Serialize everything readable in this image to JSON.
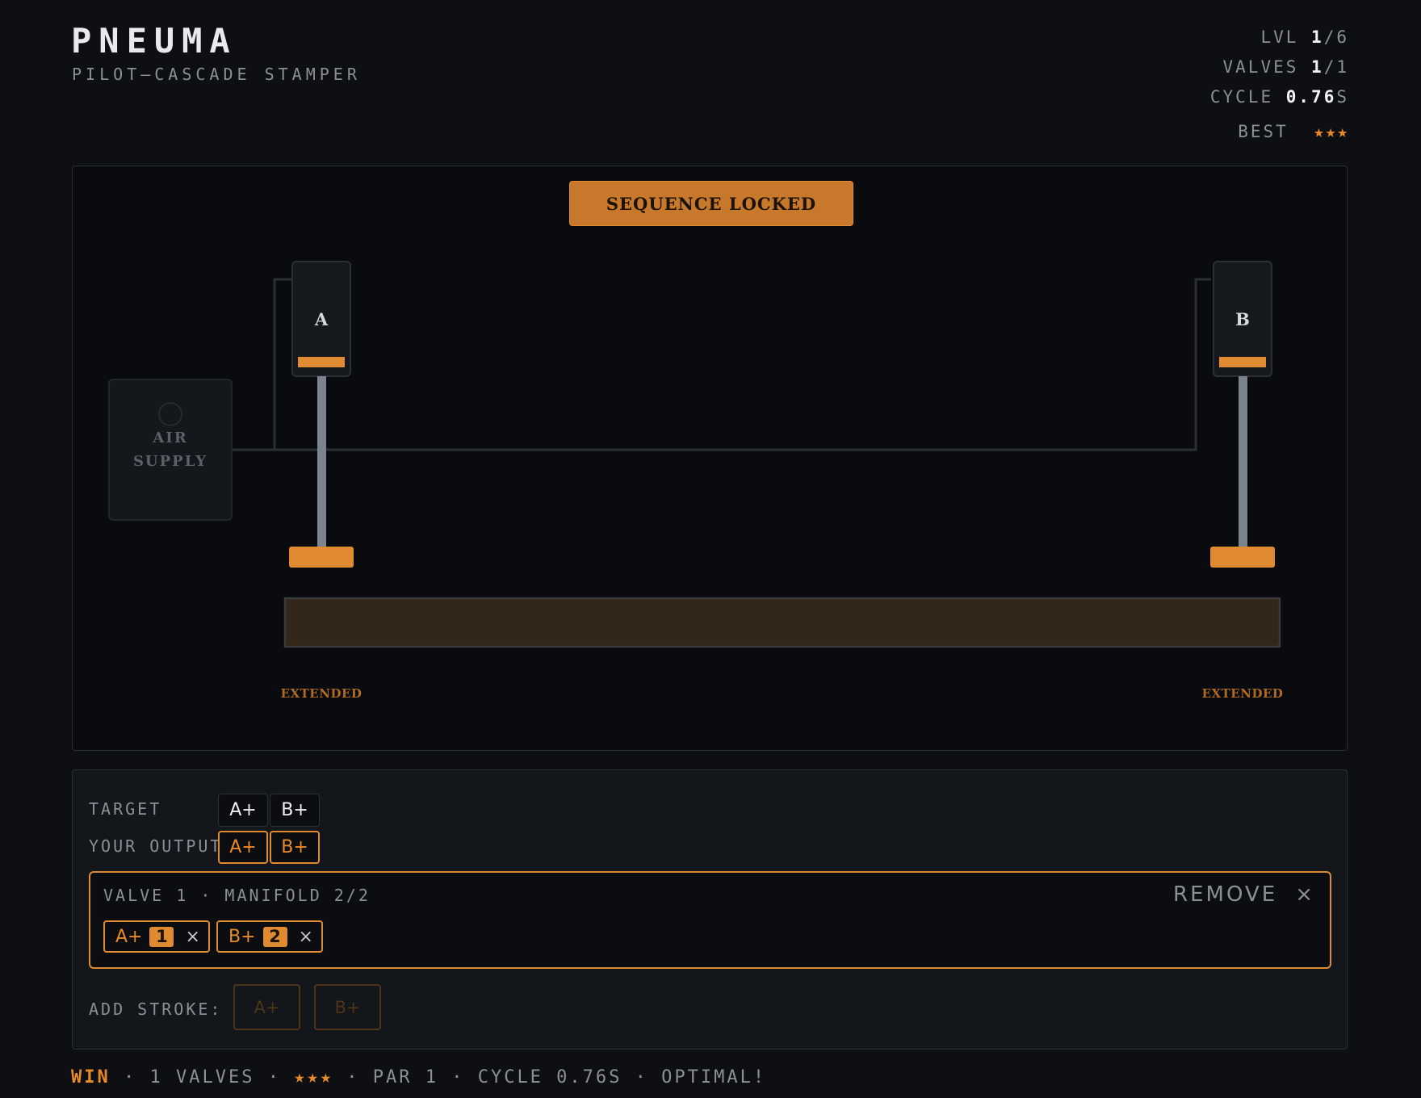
{
  "header": {
    "title": "PNEUMA",
    "subtitle": "PILOT–CASCADE STAMPER"
  },
  "stats": {
    "level_label": "LVL",
    "level_current": "1",
    "level_total": "/6",
    "valves_label": "VALVES",
    "valves_current": "1",
    "valves_total": "/1",
    "cycle_label": "CYCLE",
    "cycle_value": "0.76",
    "cycle_unit": "S",
    "best_label": "BEST",
    "best_stars": "★★★",
    "best_star_count": 3
  },
  "board": {
    "banner": "SEQUENCE LOCKED",
    "air_supply_label": "AIR\nSUPPLY",
    "cylinders": [
      {
        "name": "A",
        "state": "EXTENDED"
      },
      {
        "name": "B",
        "state": "EXTENDED"
      }
    ]
  },
  "panel": {
    "target_label": "TARGET",
    "target": [
      "A+",
      "B+"
    ],
    "output_label": "YOUR OUTPUT",
    "output": [
      "A+",
      "B+"
    ],
    "valve": {
      "title": "VALVE 1 · MANIFOLD 2/2",
      "remove_label": "REMOVE",
      "remove_icon": "×",
      "strokes": [
        {
          "stroke": "A+",
          "step": "1"
        },
        {
          "stroke": "B+",
          "step": "2"
        }
      ],
      "stroke_remove_icon": "×"
    },
    "add_stroke_label": "ADD STROKE:",
    "add_stroke_options": [
      "A+",
      "B+"
    ]
  },
  "footer": {
    "status": "WIN",
    "sep": " · ",
    "valves": "1 VALVES",
    "stars": "★★★",
    "par": "PAR 1",
    "cycle": "CYCLE 0.76S",
    "verdict": "OPTIMAL!"
  },
  "colors": {
    "accent": "#e08a32",
    "background": "#0c0e11",
    "panel": "#13161a",
    "text_muted": "#8b9097",
    "text_bright": "#f2f3f5"
  }
}
